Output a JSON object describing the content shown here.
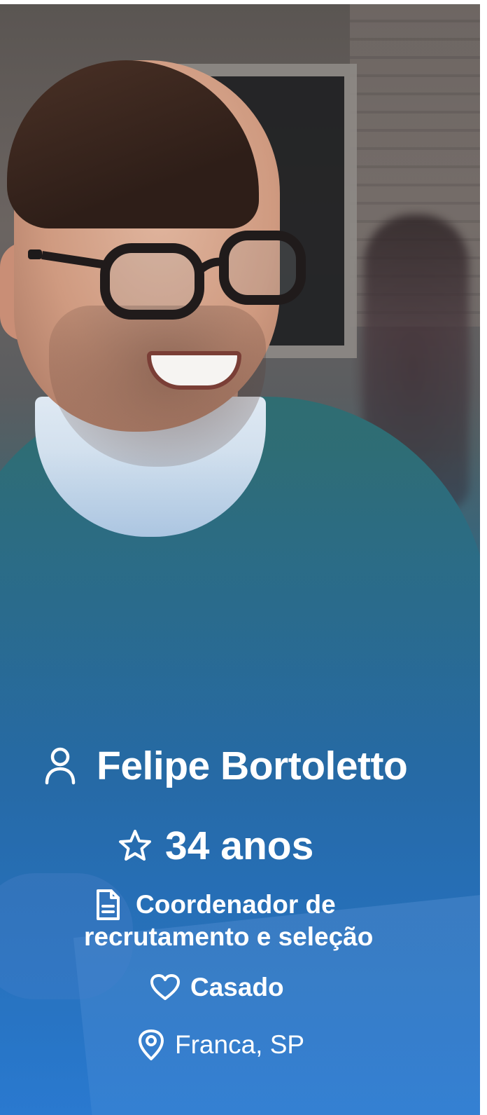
{
  "profile": {
    "name": "Felipe Bortoletto",
    "age": "34 anos",
    "job_line1": "Coordenador de",
    "job_line2": "recrutamento e seleção",
    "marital_status": "Casado",
    "location": "Franca, SP"
  },
  "icons": {
    "name": "user-icon",
    "age": "star-icon",
    "job": "document-icon",
    "marital_status": "heart-icon",
    "location": "map-pin-icon"
  },
  "colors": {
    "text": "#ffffff",
    "overlay_blue": "#2f80d2",
    "sweater_teal": "#2f6d72"
  }
}
